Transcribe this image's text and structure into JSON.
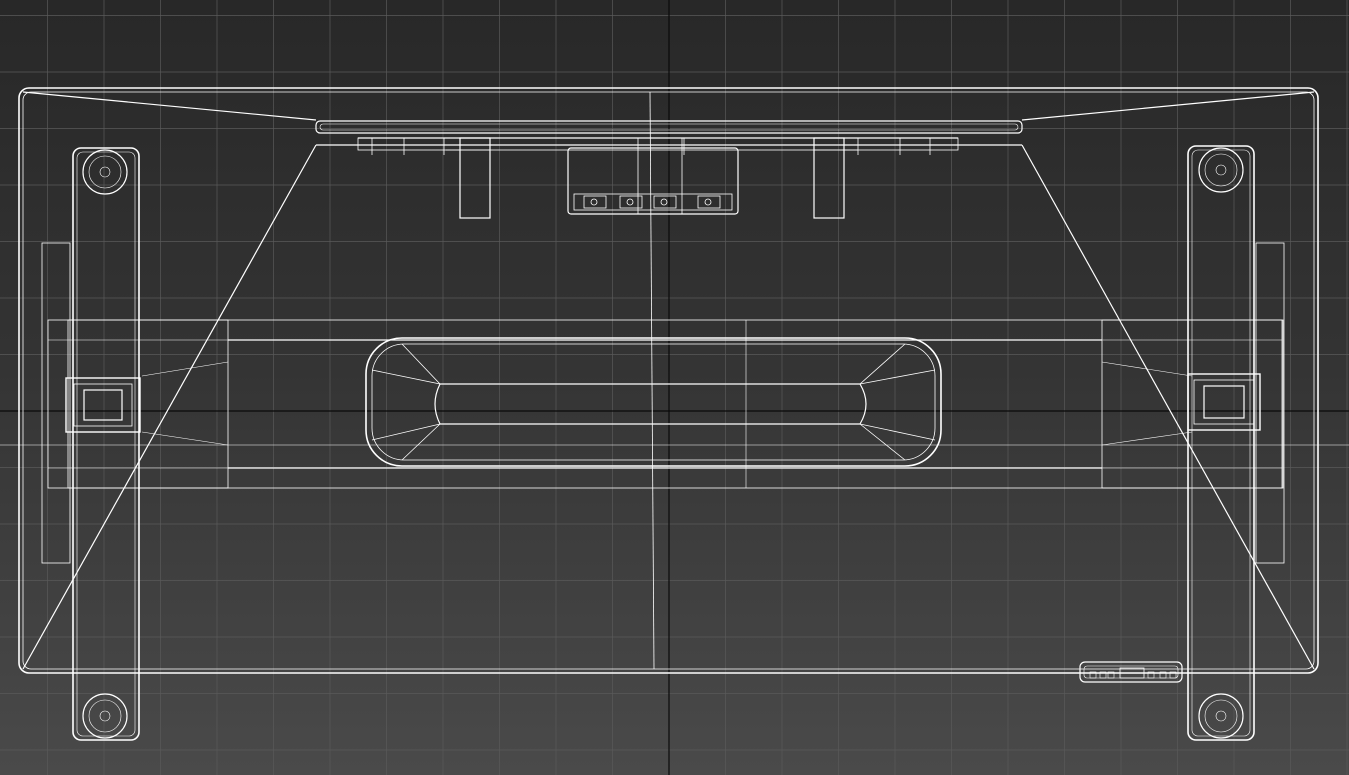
{
  "viewport": {
    "view": "top-orthographic",
    "render_mode": "wireframe",
    "grid_visible": true,
    "colors": {
      "background_top": "#282828",
      "background_bottom": "#4a4a4a",
      "grid_line": "#5a5a5a",
      "grid_axis": "#0a0a0a",
      "wireframe": "#ffffff"
    }
  },
  "model": {
    "name": "desk-frame",
    "parts": [
      "tabletop-outline",
      "rear-mount-assembly",
      "left-leg",
      "right-leg",
      "center-crossbar",
      "center-slot-handle",
      "control-panel"
    ]
  }
}
